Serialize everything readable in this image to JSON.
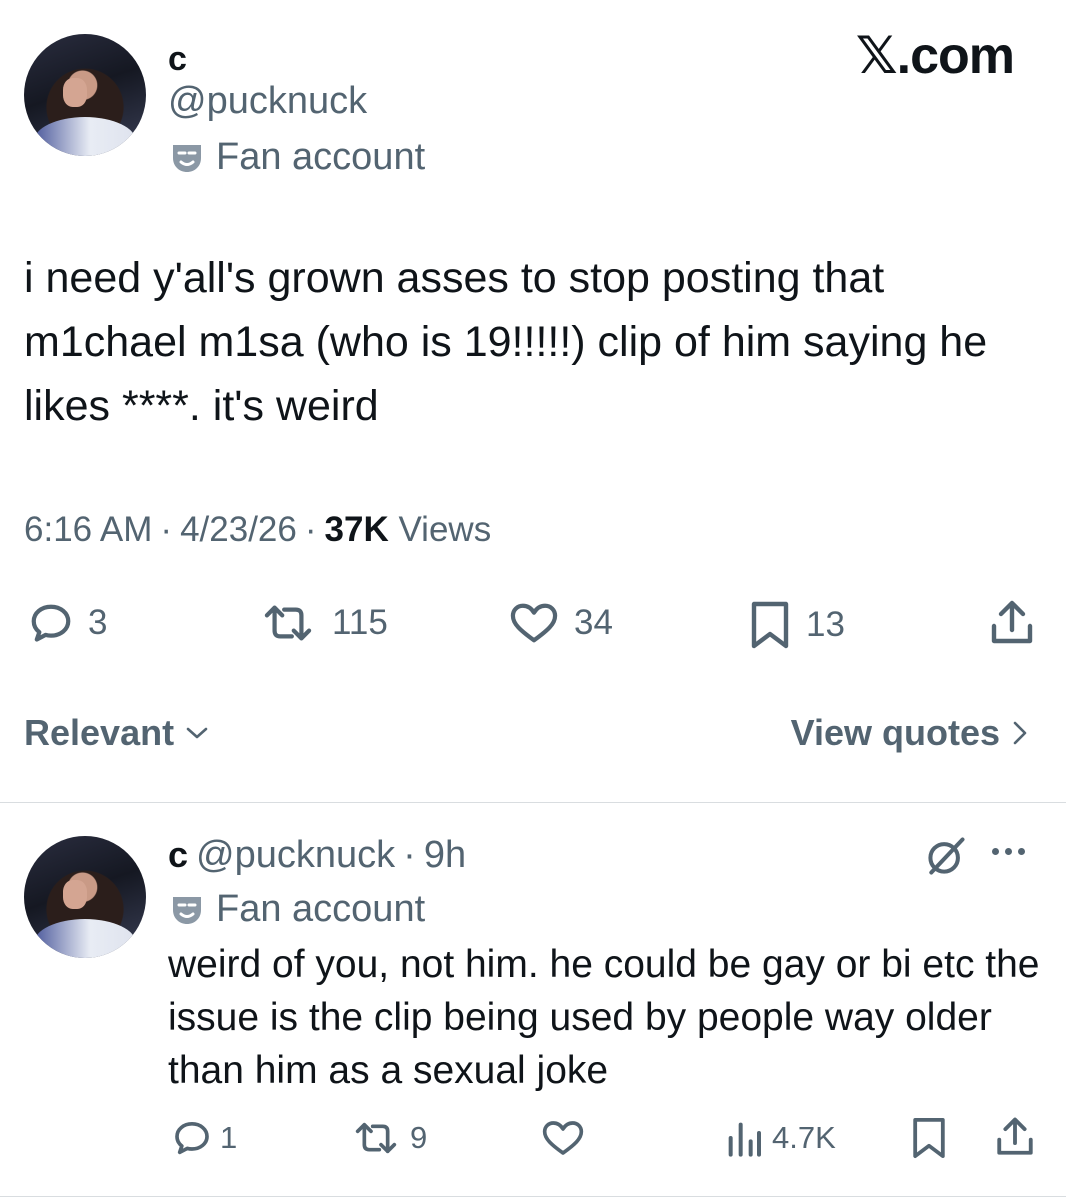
{
  "brand": "𝕏.com",
  "main_tweet": {
    "display_name": "c",
    "handle": "@pucknuck",
    "badge": "Fan account",
    "text": "i need y'all's grown asses to stop posting that m1chael m1sa (who is 19!!!!!) clip of him saying he likes ****. it's weird",
    "time": "6:16 AM",
    "date": "4/23/26",
    "views_count": "37K",
    "views_label": "Views",
    "sep": "·",
    "actions": {
      "replies": "3",
      "reposts": "115",
      "likes": "34",
      "bookmarks": "13"
    }
  },
  "sort": {
    "label": "Relevant",
    "view_quotes": "View quotes"
  },
  "reply": {
    "display_name": "c",
    "handle": "@pucknuck",
    "sep": "·",
    "time_ago": "9h",
    "badge": "Fan account",
    "text": "weird of you, not him. he could be gay or bi etc the issue is the clip being used by people way older than him as a sexual joke",
    "actions": {
      "replies": "1",
      "reposts": "9",
      "likes": "",
      "views": "4.7K"
    }
  },
  "icons": [
    "avatar",
    "fan-account-mask-icon",
    "reply-icon",
    "repost-icon",
    "like-icon",
    "bookmark-icon",
    "share-icon",
    "chevron-down-icon",
    "chevron-right-icon",
    "grok-icon",
    "more-icon",
    "views-icon"
  ]
}
